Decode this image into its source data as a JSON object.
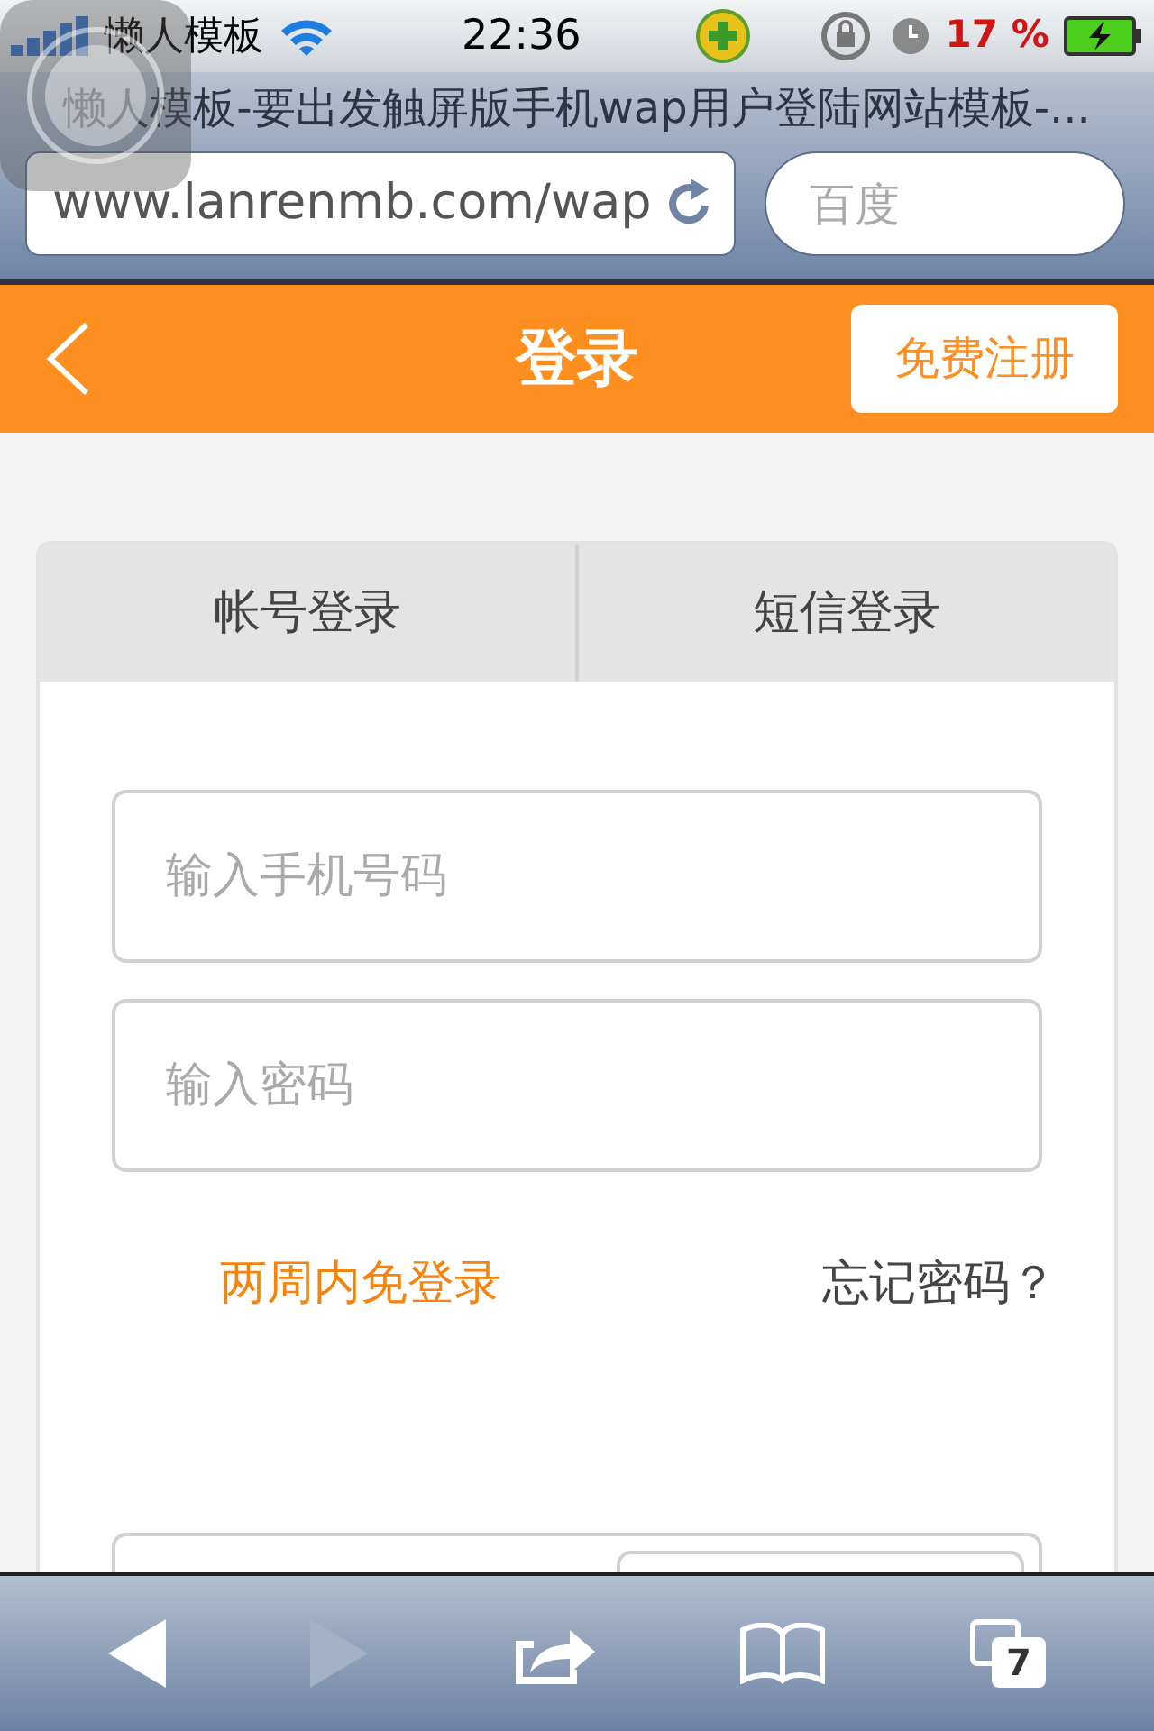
{
  "status_bar": {
    "carrier": "懒人模板",
    "time": "22:36",
    "battery": "17 %"
  },
  "browser": {
    "title": "懒人模板-要出发触屏版手机wap用户登陆网站模板-...",
    "url": "www.lanrenmb.com/wap",
    "search_placeholder": "百度"
  },
  "header": {
    "title": "登录",
    "register_button": "免费注册"
  },
  "tabs": [
    {
      "label": "帐号登录"
    },
    {
      "label": "短信登录"
    }
  ],
  "fields": [
    {
      "placeholder": "输入手机号码"
    },
    {
      "placeholder": "输入密码"
    }
  ],
  "links": {
    "remember": "两周内免登录",
    "forgot": "忘记密码？"
  },
  "toolbar": {
    "tab_count": "7"
  }
}
